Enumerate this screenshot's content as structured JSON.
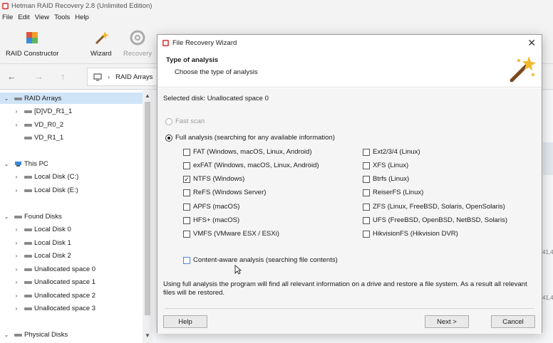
{
  "app": {
    "title": "Hetman RAID Recovery 2.8 (Unlimited Edition)",
    "menu": [
      "File",
      "Edit",
      "View",
      "Tools",
      "Help"
    ],
    "toolbar": {
      "raid_constructor": "RAID Constructor",
      "wizard": "Wizard",
      "recovery": "Recovery"
    },
    "breadcrumb": {
      "root_icon": "computer-icon",
      "item": "RAID Arrays"
    },
    "tree": [
      {
        "label": "RAID Arrays",
        "level": 0,
        "expanded": true,
        "selected": true
      },
      {
        "label": "[D]VD_R1_1",
        "level": 1
      },
      {
        "label": "VD_R0_2",
        "level": 1
      },
      {
        "label": "VD_R1_1",
        "level": 1
      },
      {
        "label": "This PC",
        "level": 0,
        "expanded": true
      },
      {
        "label": "Local Disk (C:)",
        "level": 1
      },
      {
        "label": "Local Disk (E:)",
        "level": 1
      },
      {
        "label": "Found Disks",
        "level": 0,
        "expanded": true
      },
      {
        "label": "Local Disk 0",
        "level": 1
      },
      {
        "label": "Local Disk 1",
        "level": 1
      },
      {
        "label": "Local Disk 2",
        "level": 1
      },
      {
        "label": "Unallocated space 0",
        "level": 1
      },
      {
        "label": "Unallocated space 1",
        "level": 1
      },
      {
        "label": "Unallocated space 2",
        "level": 1
      },
      {
        "label": "Unallocated space 3",
        "level": 1
      },
      {
        "label": "Physical Disks",
        "level": 0,
        "expanded": true
      }
    ],
    "right_fragments": [
      "41,4",
      "41,4"
    ]
  },
  "dialog": {
    "title": "File Recovery Wizard",
    "header_title": "Type of analysis",
    "header_subtitle": "Choose the type of analysis",
    "selected_disk": "Selected disk: Unallocated space 0",
    "fast_scan": "Fast scan",
    "full_analysis": "Full analysis (searching for any available information)",
    "fs_left": [
      {
        "label": "FAT (Windows, macOS, Linux, Android)",
        "checked": false
      },
      {
        "label": "exFAT (Windows, macOS, Linux, Android)",
        "checked": false
      },
      {
        "label": "NTFS (Windows)",
        "checked": true
      },
      {
        "label": "ReFS (Windows Server)",
        "checked": false
      },
      {
        "label": "APFS (macOS)",
        "checked": false
      },
      {
        "label": "HFS+ (macOS)",
        "checked": false
      },
      {
        "label": "VMFS (VMware ESX / ESXi)",
        "checked": false
      }
    ],
    "fs_right": [
      {
        "label": "Ext2/3/4 (Linux)",
        "checked": false
      },
      {
        "label": "XFS (Linux)",
        "checked": false
      },
      {
        "label": "Btrfs (Linux)",
        "checked": false
      },
      {
        "label": "ReiserFS (Linux)",
        "checked": false
      },
      {
        "label": "ZFS (Linux, FreeBSD, Solaris, OpenSolaris)",
        "checked": false
      },
      {
        "label": "UFS (FreeBSD, OpenBSD, NetBSD, Solaris)",
        "checked": false
      },
      {
        "label": "HikvisionFS (Hikvision DVR)",
        "checked": false
      }
    ],
    "content_aware": "Content-aware analysis (searching file contents)",
    "description": "Using full analysis the program will find all relevant information on a drive and restore a file system. As a result all relevant files will be restored.",
    "help_label": "Help",
    "next_label": "Next >",
    "cancel_label": "Cancel"
  }
}
